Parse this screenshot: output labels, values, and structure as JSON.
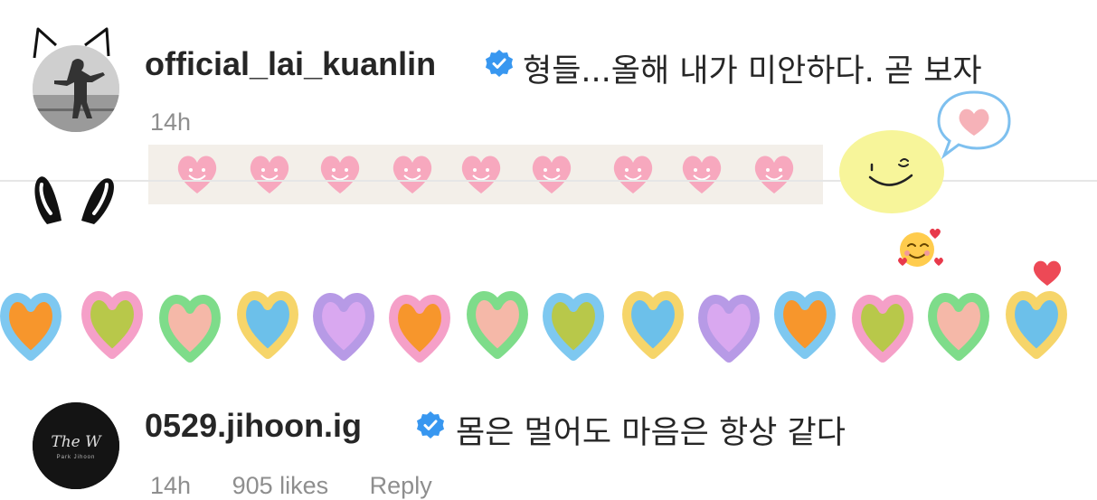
{
  "comments": [
    {
      "username": "official_lai_kuanlin",
      "text": "형들...올해 내가 미안하다. 곧 보자",
      "time": "14h"
    },
    {
      "username": "0529.jihoon.ig",
      "text": "몸은 멀어도 마음은 항상 같다",
      "emoji": "smiling-face-with-hearts",
      "time": "14h",
      "likes": "905 likes",
      "reply": "Reply",
      "avatar_text": "The W",
      "avatar_subtext": "Park Jihoon"
    }
  ],
  "colors": {
    "verified": "#3897f0",
    "meta": "#8e8e8e",
    "tape_heart": "#f7a8be",
    "sticker_yellow": "#f7f59a"
  }
}
